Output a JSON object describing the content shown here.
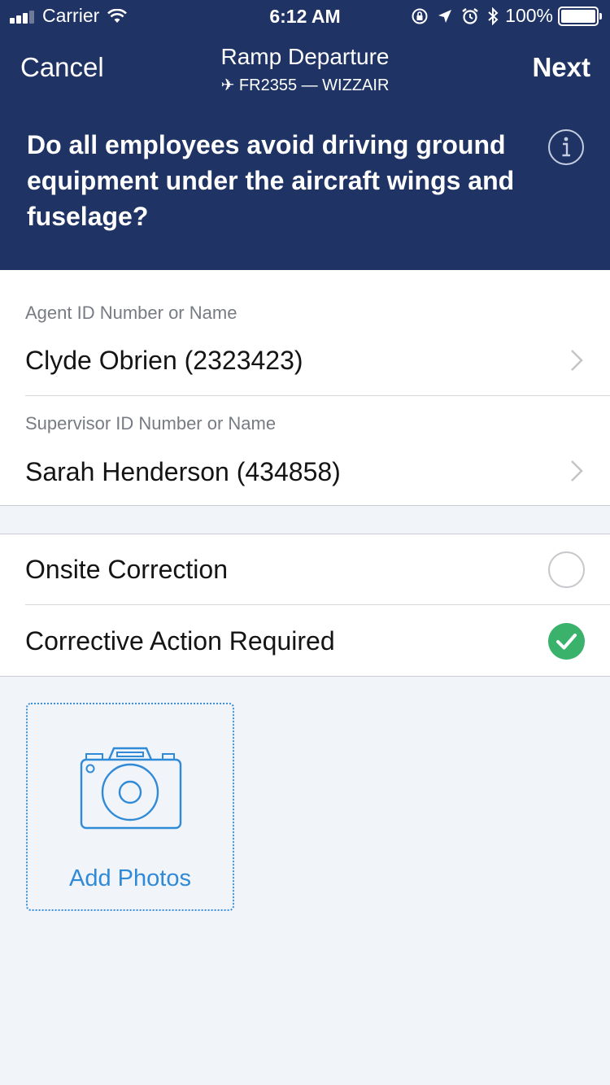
{
  "status_bar": {
    "carrier": "Carrier",
    "time": "6:12 AM",
    "battery_percent": "100%",
    "signal_bars": 3,
    "icons": [
      "signal-icon",
      "wifi-icon",
      "rotation-lock-icon",
      "location-icon",
      "alarm-icon",
      "bluetooth-icon",
      "battery-icon"
    ]
  },
  "nav": {
    "cancel_label": "Cancel",
    "title": "Ramp Departure",
    "subtitle": "✈ FR2355 — WIZZAIR",
    "next_label": "Next"
  },
  "question": {
    "text": "Do all employees avoid driving ground equipment under the aircraft wings and fuselage?",
    "info_icon": "info-icon"
  },
  "fields": [
    {
      "label": "Agent ID Number or Name",
      "value": "Clyde Obrien (2323423)"
    },
    {
      "label": "Supervisor ID Number or Name",
      "value": "Sarah Henderson (434858)"
    }
  ],
  "options": [
    {
      "label": "Onsite Correction",
      "checked": false
    },
    {
      "label": "Corrective Action Required",
      "checked": true
    }
  ],
  "photos": {
    "add_label": "Add Photos",
    "icon": "camera-icon"
  },
  "colors": {
    "header_bg": "#1f3465",
    "accent_blue": "#2f8ad8",
    "check_green": "#3bb26b",
    "page_bg": "#f1f4f9"
  }
}
